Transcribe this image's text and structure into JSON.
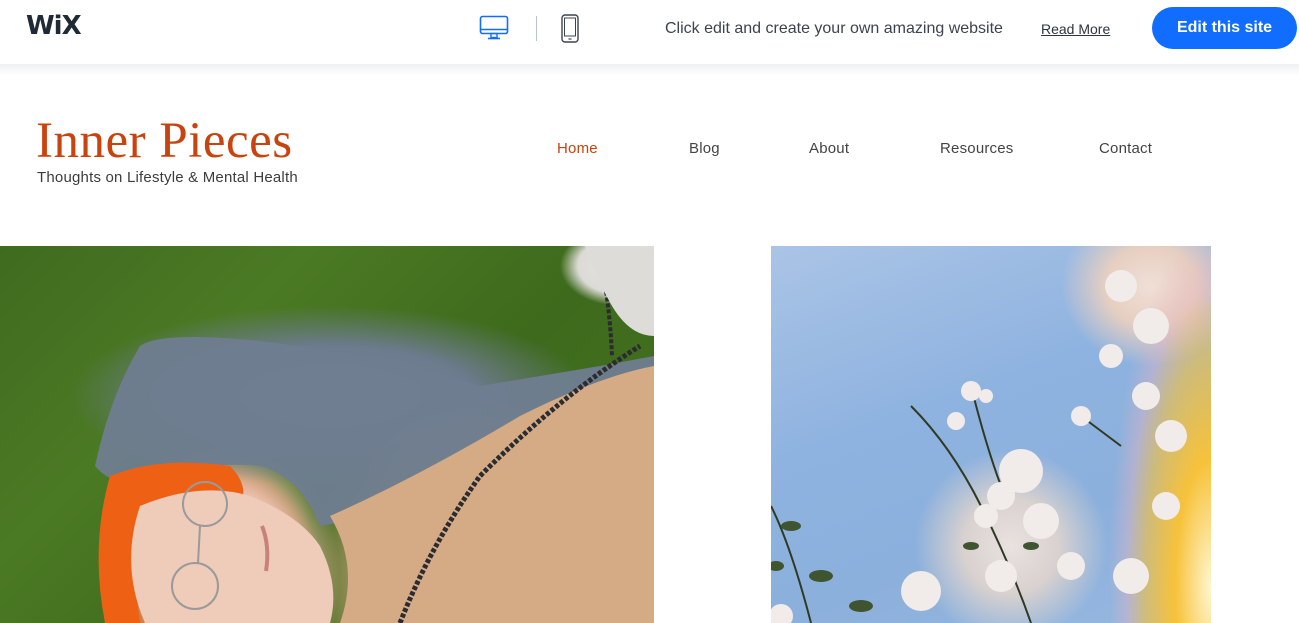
{
  "wix_bar": {
    "logo": "WiX",
    "device_icons": {
      "desktop": "desktop-icon",
      "mobile": "mobile-icon"
    },
    "promo_text": "Click edit and create your own amazing website",
    "read_more_label": "Read More",
    "edit_button_label": "Edit this site",
    "accent_color": "#116dff"
  },
  "site": {
    "title": "Inner Pieces",
    "tagline": "Thoughts on Lifestyle & Mental Health",
    "brand_color": "#c9430f",
    "nav": [
      {
        "label": "Home",
        "active": true
      },
      {
        "label": "Blog",
        "active": false
      },
      {
        "label": "About",
        "active": false
      },
      {
        "label": "Resources",
        "active": false
      },
      {
        "label": "Contact",
        "active": false
      }
    ]
  },
  "images": [
    {
      "description": "Person with orange beanie and round glasses lying on grass"
    },
    {
      "description": "Cherry blossom branches against blue sky with warm light flare"
    }
  ]
}
